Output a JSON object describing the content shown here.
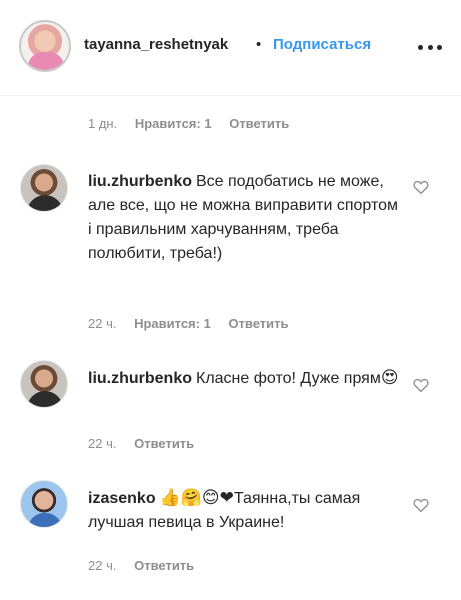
{
  "header": {
    "username": "tayanna_reshetnyak",
    "separator": "•",
    "follow_label": "Подписаться"
  },
  "top_meta": {
    "time": "1 дн.",
    "likes": "Нравится: 1",
    "reply": "Ответить"
  },
  "comments": [
    {
      "user": "liu.zhurbenko",
      "text": "Все подобатись не може, але все, що не можна виправити спортом і правильним харчуванням, треба полюбити, треба!)",
      "time": "22 ч.",
      "likes": "Нравится: 1",
      "reply": "Ответить"
    },
    {
      "user": "liu.zhurbenko",
      "text": "Класне фото! Дуже прям",
      "emoji": "😍",
      "time": "22 ч.",
      "reply": "Ответить"
    },
    {
      "user": "izasenko",
      "emoji": "👍🤗😊❤",
      "text": "Таянна,ты самая лучшая певица в Украине!",
      "time": "22 ч.",
      "reply": "Ответить"
    }
  ],
  "colors": {
    "link_blue": "#3897f0",
    "meta_grey": "#8e8e8e",
    "text": "#262626"
  },
  "icons": [
    "more-horizontal-icon",
    "heart-outline-icon"
  ]
}
